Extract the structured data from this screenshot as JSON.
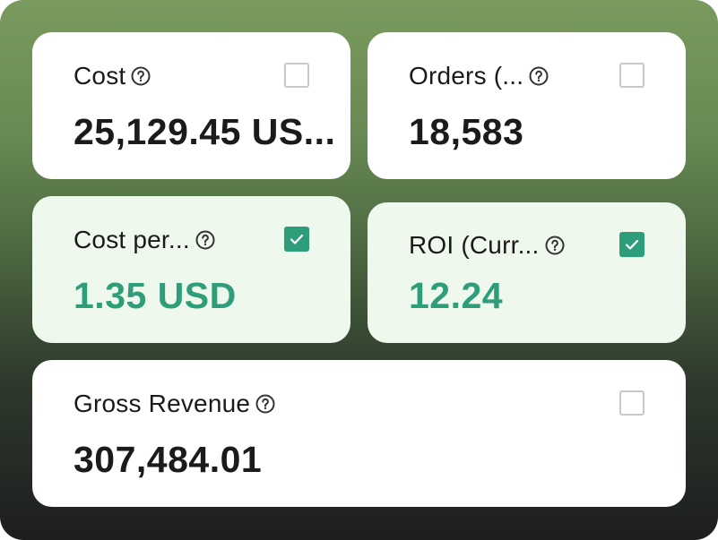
{
  "colors": {
    "accent": "#2e9e7a",
    "selected_card_bg": "#eef8ec",
    "card_bg": "#ffffff"
  },
  "metrics": [
    {
      "title": "Cost",
      "value": "25,129.45 US...",
      "checked": false
    },
    {
      "title": "Orders (...",
      "value": "18,583",
      "checked": false
    },
    {
      "title": "Cost per...",
      "value": "1.35 USD",
      "checked": true
    },
    {
      "title": "ROI (Curr...",
      "value": "12.24",
      "checked": true
    },
    {
      "title": "Gross Revenue",
      "value": "307,484.01",
      "checked": false
    }
  ]
}
